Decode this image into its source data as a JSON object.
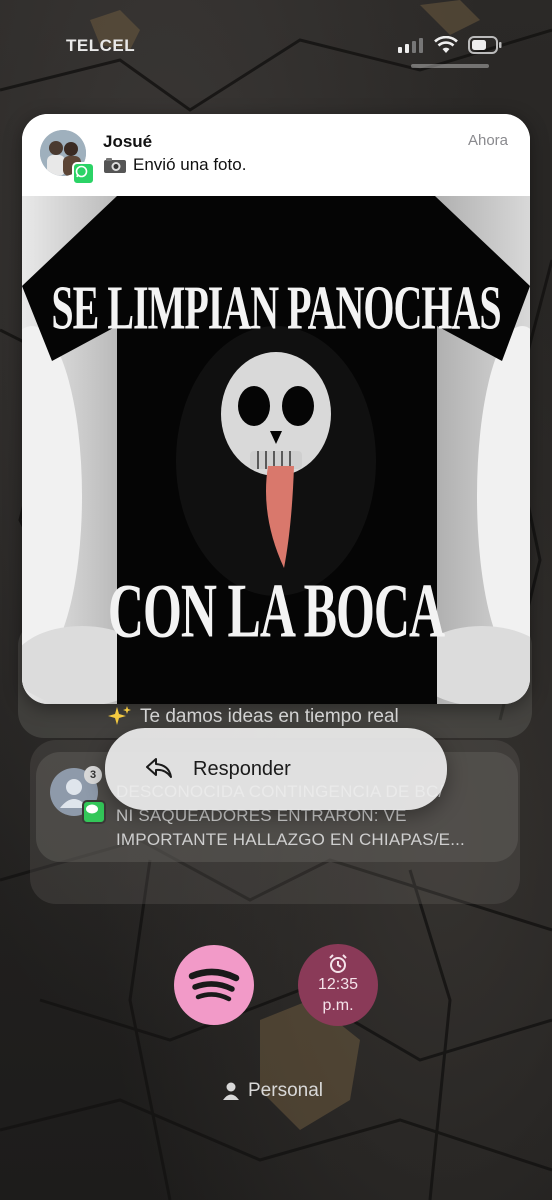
{
  "status_bar": {
    "carrier": "TELCEL",
    "icons": [
      "signal-icon",
      "wifi-icon",
      "battery-icon"
    ]
  },
  "notification": {
    "app_icon": "whatsapp-icon",
    "sender": "Josué",
    "time": "Ahora",
    "message_icon": "camera-icon",
    "message": "Envió una foto.",
    "photo": {
      "text_top": "SE LIMPIAN PANOCHAS",
      "text_bottom": "CON LA BOCA"
    }
  },
  "suggestion": {
    "icon": "sparkles-icon",
    "text": "Te damos ideas en tiempo real"
  },
  "second_notification": {
    "app_icon": "messages-icon",
    "count": "3",
    "line1": "DESCONOCIDA CONTINGENCIA DE BC/",
    "line2": "NI SAQUEADORES ENTRARON: VE",
    "line3": "IMPORTANTE HALLAZGO EN CHIAPAS/E..."
  },
  "context_menu": {
    "reply_icon": "reply-icon",
    "reply_label": "Responder"
  },
  "widgets": {
    "spotify_icon": "spotify-icon",
    "clock_icon": "alarm-clock-icon",
    "clock_time": "12:35",
    "clock_ampm": "p.m."
  },
  "focus": {
    "icon": "person-icon",
    "label": "Personal"
  },
  "colors": {
    "spotify_pink": "#f29ac8",
    "clock_bg": "#8a3a58",
    "whatsapp_green": "#2bd366"
  }
}
